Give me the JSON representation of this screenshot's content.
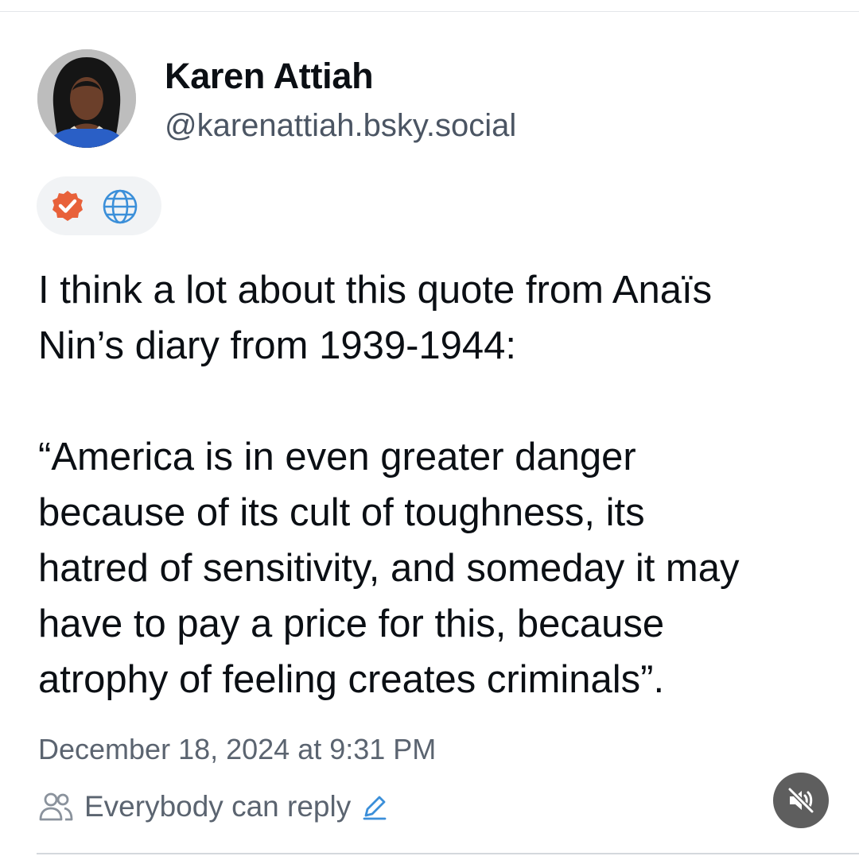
{
  "author": {
    "display_name": "Karen Attiah",
    "handle": "@karenattiah.bsky.social",
    "avatar_icon": "profile-photo"
  },
  "badges": {
    "verified_icon": "verified-check-icon",
    "verified_color": "#e8613a",
    "globe_icon": "globe-icon",
    "globe_color": "#3b8fd9"
  },
  "post": {
    "text": "I think a lot about this quote from Anaïs\nNin’s diary from 1939-1944:\n\n“America is in even greater danger\nbecause of its cult of toughness, its\nhatred of sensitivity, and someday it may\nhave to pay a price for this, because\natrophy of feeling creates criminals”.",
    "timestamp": "December 18, 2024 at 9:31 PM"
  },
  "reply_settings": {
    "icon": "people-icon",
    "label": "Everybody can reply",
    "edit_icon": "pencil-icon"
  },
  "media_controls": {
    "mute_icon": "speaker-muted-icon"
  }
}
